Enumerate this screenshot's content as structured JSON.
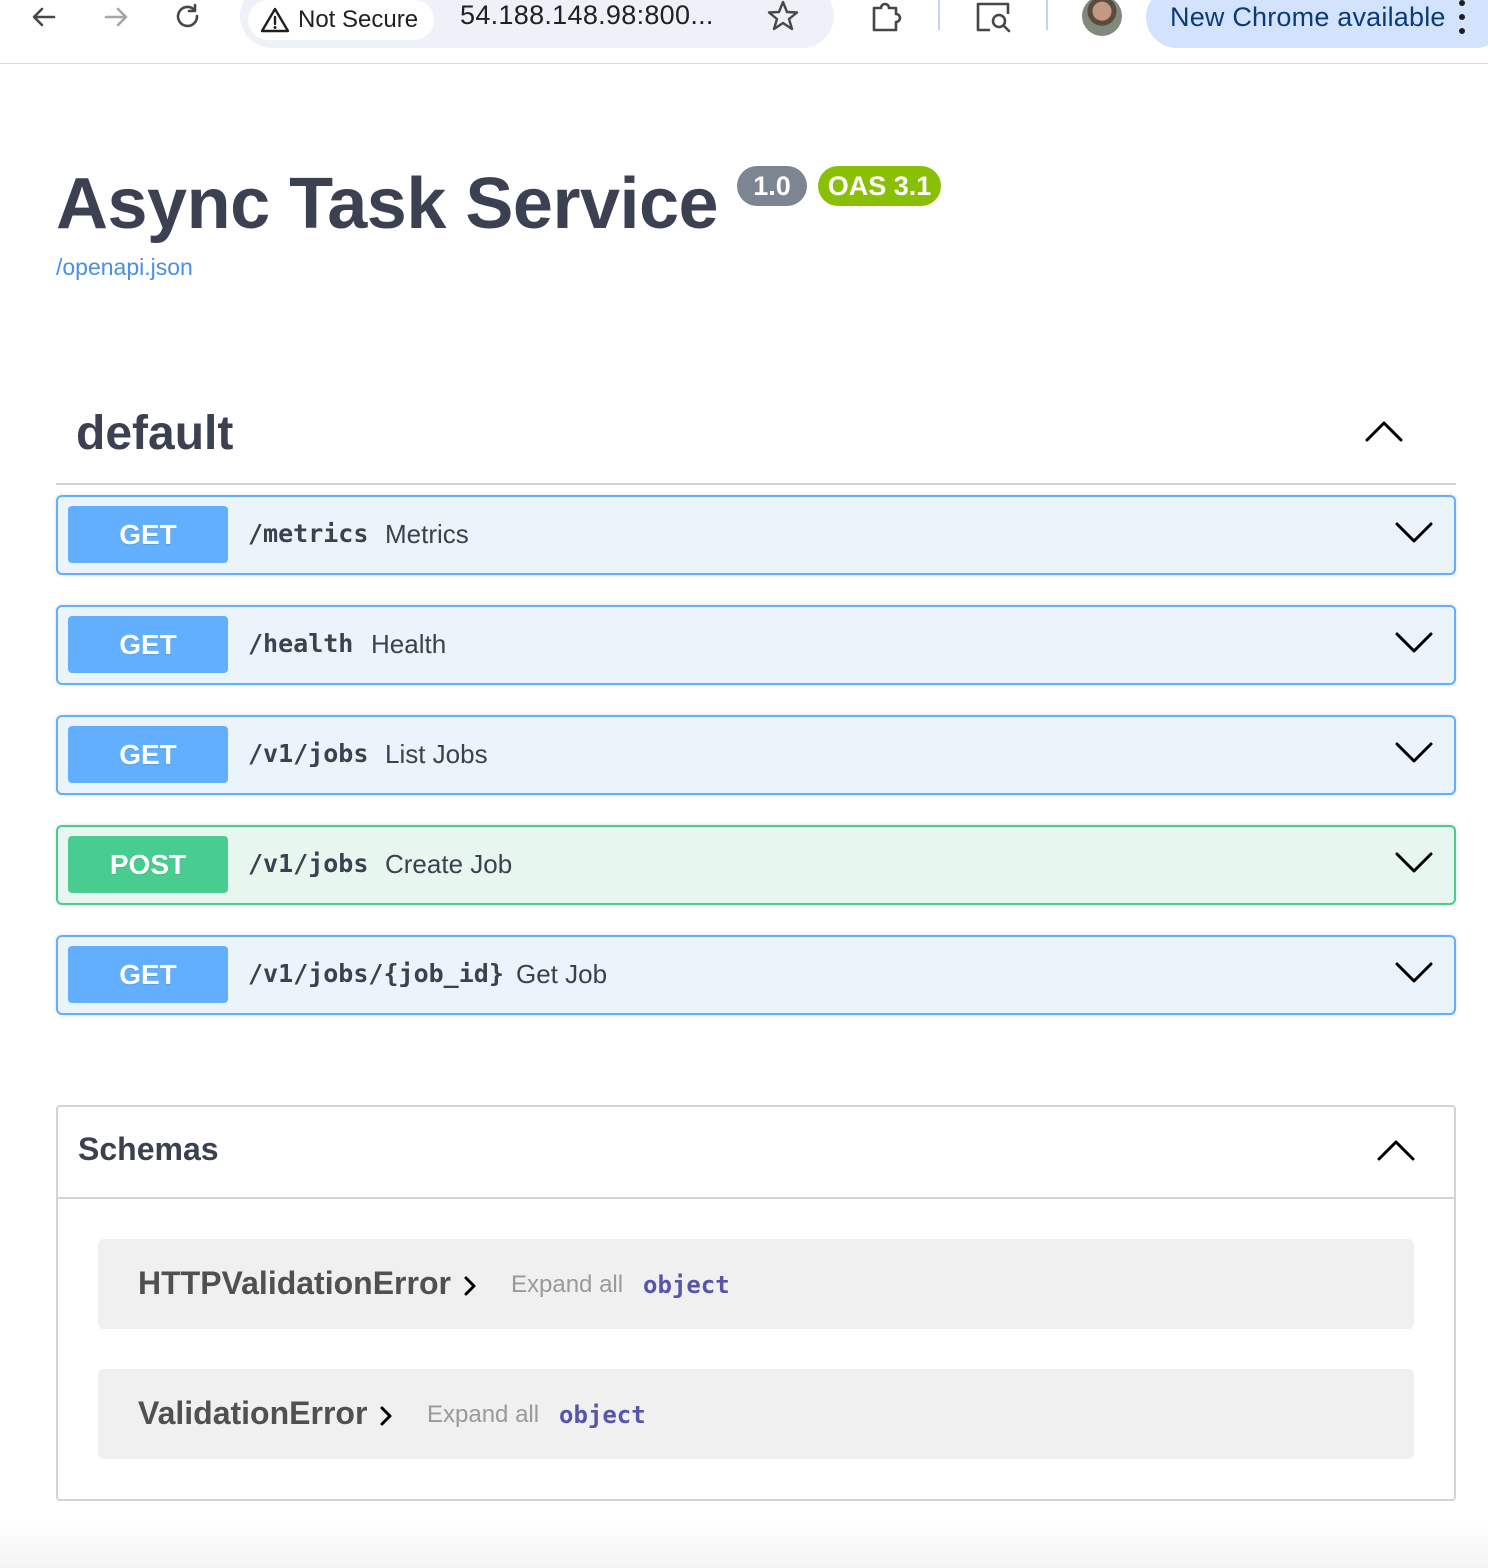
{
  "browser": {
    "security_label": "Not Secure",
    "url": "54.188.148.98:800...",
    "update_label": "New Chrome available"
  },
  "info": {
    "title": "Async Task Service",
    "version": "1.0",
    "oas_version": "OAS 3.1",
    "spec_link": "/openapi.json"
  },
  "tag": {
    "name": "default"
  },
  "operations": [
    {
      "method": "GET",
      "path": "/metrics",
      "summary": "Metrics"
    },
    {
      "method": "GET",
      "path": "/health",
      "summary": "Health"
    },
    {
      "method": "GET",
      "path": "/v1/jobs",
      "summary": "List Jobs"
    },
    {
      "method": "POST",
      "path": "/v1/jobs",
      "summary": "Create Job"
    },
    {
      "method": "GET",
      "path": "/v1/jobs/{job_id}",
      "summary": "Get Job"
    }
  ],
  "schemas": {
    "title": "Schemas",
    "models": [
      {
        "name": "HTTPValidationError",
        "expand_label": "Expand all",
        "type": "object"
      },
      {
        "name": "ValidationError",
        "expand_label": "Expand all",
        "type": "object"
      }
    ]
  },
  "colors": {
    "get": "#61affe",
    "post": "#49cc90",
    "version_badge": "#7d8492",
    "oas_badge": "#89bf04",
    "link": "#4990e2"
  },
  "icons": [
    "back-arrow-icon",
    "forward-arrow-icon",
    "reload-icon",
    "warning-icon",
    "star-icon",
    "extensions-icon",
    "page-search-icon",
    "chevron-up-icon",
    "chevron-down-icon",
    "chevron-right-icon",
    "more-vert-icon"
  ]
}
